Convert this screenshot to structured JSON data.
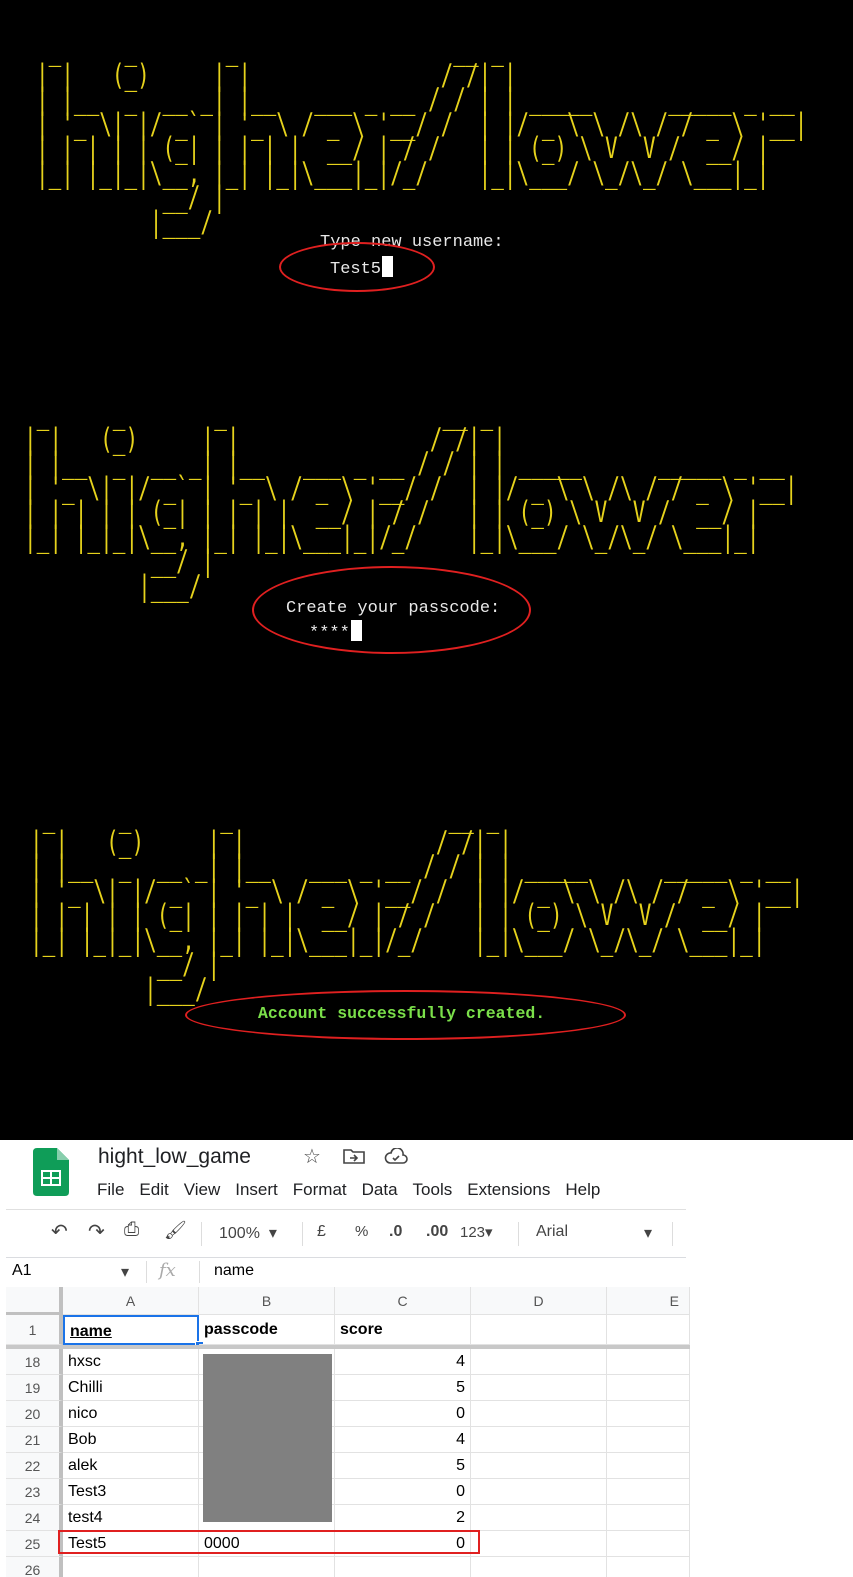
{
  "ascii_logo": [
    " _     _       _                 __ _",
    "| |   (_)     | |               / /| |",
    "| |__  _  __ _| |__   ___ _ __ / / | | _____      _____ _ __",
    "| '_ \\| |/ _` | '_ \\ / _ \\ '__/ /  | |/ _ \\ \\ /\\ / / _ \\ '__|",
    "| | | | | (_| | | | |  __/ | / /   | | (_) \\ V  V /  __/ |",
    "|_| |_|_|\\__, |_| |_|\\___|_|/_/    |_|\\___/ \\_/\\_/ \\___|_|",
    "          __/ |",
    "         |___/"
  ],
  "terminal": {
    "username_prompt": "Type new username:",
    "username_value": "Test5",
    "passcode_prompt": "Create your passcode:",
    "passcode_value": "****",
    "success_message": "Account successfully created."
  },
  "colors": {
    "ascii": "#e6d21c",
    "success": "#7be04a",
    "highlight": "#e02020",
    "sheets_green": "#0f9d58"
  },
  "spreadsheet": {
    "title": "hight_low_game",
    "menu": [
      "File",
      "Edit",
      "View",
      "Insert",
      "Format",
      "Data",
      "Tools",
      "Extensions",
      "Help"
    ],
    "toolbar": {
      "zoom": "100%",
      "currency": "£",
      "percent": "%",
      "dec_decrease": ".0",
      "dec_increase": ".00",
      "more_formats": "123",
      "font": "Arial"
    },
    "name_box": "A1",
    "fx": "fx",
    "formula_value": "name",
    "column_headers": [
      "A",
      "B",
      "C",
      "D",
      "E"
    ],
    "header_row": {
      "num": "1",
      "cells": [
        "name",
        "passcode",
        "score",
        ""
      ]
    },
    "rows": [
      {
        "num": "18",
        "name": "hxsc",
        "passcode": "",
        "score": "4"
      },
      {
        "num": "19",
        "name": "Chilli",
        "passcode": "",
        "score": "5"
      },
      {
        "num": "20",
        "name": "nico",
        "passcode": "",
        "score": "0"
      },
      {
        "num": "21",
        "name": "Bob",
        "passcode": "",
        "score": "4"
      },
      {
        "num": "22",
        "name": "alek",
        "passcode": "",
        "score": "5"
      },
      {
        "num": "23",
        "name": "Test3",
        "passcode": "",
        "score": "0"
      },
      {
        "num": "24",
        "name": "test4",
        "passcode": "",
        "score": "2"
      },
      {
        "num": "25",
        "name": "Test5",
        "passcode": "0000",
        "score": "0"
      },
      {
        "num": "26",
        "name": "",
        "passcode": "",
        "score": ""
      }
    ]
  }
}
